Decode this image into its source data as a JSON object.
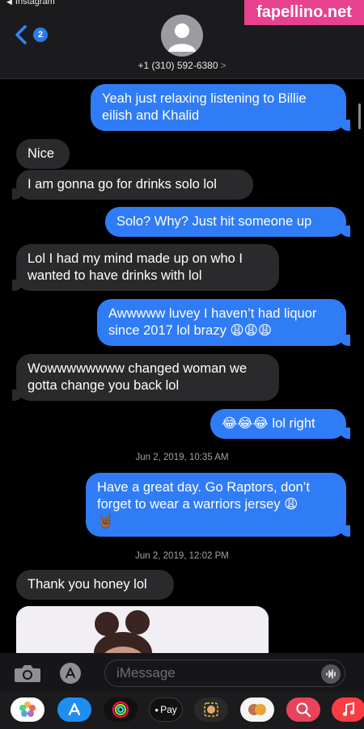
{
  "status": {
    "back_app": "Instagram"
  },
  "header": {
    "unread_count": "2",
    "contact": "+1 (310) 592-6380",
    "contact_chevron": ">"
  },
  "watermark": "fapellino.net",
  "messages": [
    {
      "id": "m1",
      "from": "sent",
      "lines": [
        "Yeah just relaxing listening to Billie",
        "eilish and Khalid"
      ]
    },
    {
      "id": "m2",
      "from": "received",
      "lines": [
        "Nice"
      ]
    },
    {
      "id": "m3",
      "from": "received",
      "lines": [
        "I am gonna go for drinks solo lol"
      ]
    },
    {
      "id": "m4",
      "from": "sent",
      "lines": [
        "Solo? Why? Just hit someone up"
      ]
    },
    {
      "id": "m5",
      "from": "received",
      "lines": [
        "Lol I had my mind made up on who I",
        "wanted to have drinks with lol"
      ]
    },
    {
      "id": "m6",
      "from": "sent",
      "lines": [
        "Awwwww luvey I haven’t had liquor",
        "since 2017 lol brazy 😩😩😩"
      ]
    },
    {
      "id": "m7",
      "from": "received",
      "lines": [
        "Wowwwwwwww changed woman we",
        "gotta change you back lol"
      ]
    },
    {
      "id": "m8",
      "from": "sent",
      "lines": [
        "😂😂😂 lol right"
      ]
    },
    {
      "id": "m9",
      "from": "sent",
      "lines": [
        "Have a great day. Go Raptors, don’t",
        "forget to wear a warriors jersey 😩",
        "🤘🏾"
      ]
    },
    {
      "id": "m10",
      "from": "received",
      "lines": [
        "Thank you honey lol"
      ]
    }
  ],
  "timestamps": [
    "Jun 2, 2019, 10:35 AM",
    "Jun 2, 2019, 12:02 PM"
  ],
  "input": {
    "placeholder": "iMessage"
  },
  "app_drawer": [
    {
      "name": "photos",
      "icon": "photos-icon",
      "color": "#ffffff"
    },
    {
      "name": "app-store",
      "icon": "app-store-icon",
      "color": "#1f8ef1"
    },
    {
      "name": "fitness",
      "icon": "fitness-rings-icon",
      "color": "#111111"
    },
    {
      "name": "apple-pay",
      "icon": "apple-pay-icon",
      "color": "#111111",
      "label": "Pay"
    },
    {
      "name": "memoji",
      "icon": "memoji-icon",
      "color": "#2a2a2a"
    },
    {
      "name": "animoji",
      "icon": "animoji-icon",
      "color": "#f5f5f5"
    },
    {
      "name": "image-search",
      "icon": "globe-search-icon",
      "color": "#e8435a"
    },
    {
      "name": "music",
      "icon": "music-note-icon",
      "color": "#fc3c44"
    }
  ],
  "colors": {
    "sent": "#2f7cf6",
    "received": "#2a2a2c",
    "badge": "#2a7be4"
  }
}
